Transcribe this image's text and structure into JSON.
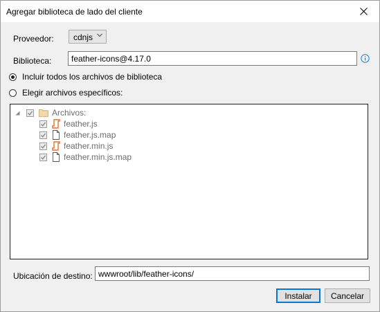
{
  "window": {
    "title": "Agregar biblioteca de lado del cliente"
  },
  "provider": {
    "label": "Proveedor:",
    "value": "cdnjs"
  },
  "library": {
    "label": "Biblioteca:",
    "value": "feather-icons@4.17.0"
  },
  "options": {
    "include_all": "Incluir todos los archivos de biblioteca",
    "choose_specific": "Elegir archivos específicos:"
  },
  "tree": {
    "root_label": "Archivos:",
    "files": [
      {
        "name": "feather.js",
        "icon": "js-file-icon"
      },
      {
        "name": "feather.js.map",
        "icon": "generic-file-icon"
      },
      {
        "name": "feather.min.js",
        "icon": "js-file-icon"
      },
      {
        "name": "feather.min.js.map",
        "icon": "generic-file-icon"
      }
    ]
  },
  "destination": {
    "label": "Ubicación de destino:",
    "value": "wwwroot/lib/feather-icons/"
  },
  "buttons": {
    "install": "Instalar",
    "cancel": "Cancelar"
  },
  "colors": {
    "accent": "#0078d7",
    "js_icon": "#e8722e",
    "folder": "#dcb67a"
  }
}
